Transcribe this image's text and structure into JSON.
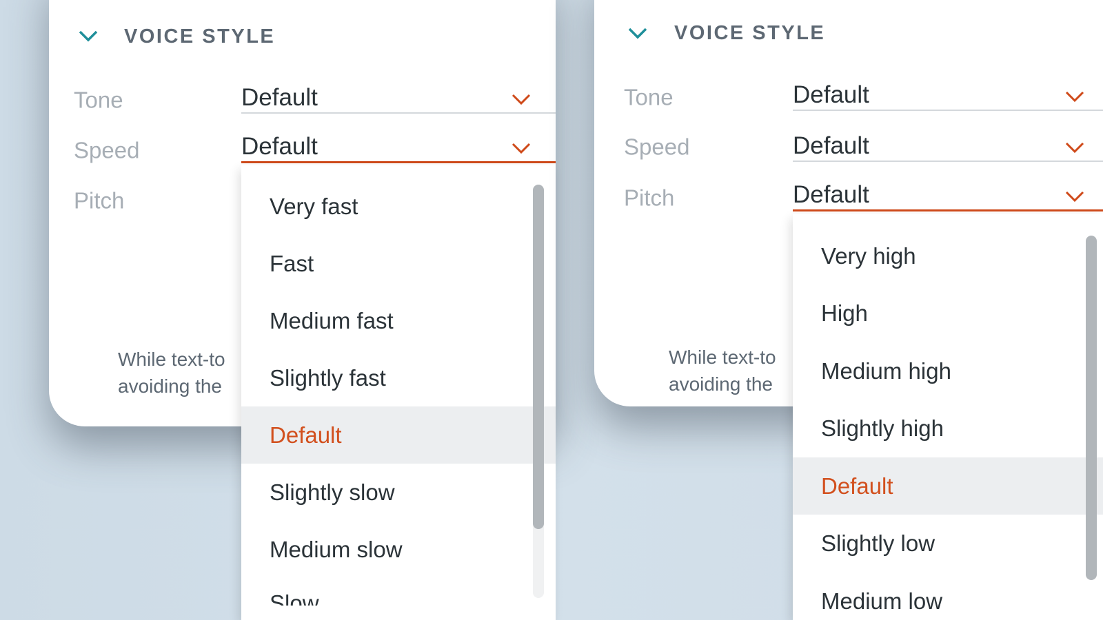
{
  "colors": {
    "accent": "#cf4a1a",
    "teal": "#1f8f9a",
    "background": "#d3e0ea"
  },
  "left": {
    "section_title": "VOICE STYLE",
    "fields": [
      {
        "label": "Tone",
        "value": "Default"
      },
      {
        "label": "Speed",
        "value": "Default"
      },
      {
        "label": "Pitch",
        "value": ""
      }
    ],
    "footer": [
      "While text-to",
      "avoiding the"
    ],
    "dropdown": {
      "options": [
        "Very fast",
        "Fast",
        "Medium fast",
        "Slightly fast",
        "Default",
        "Slightly slow",
        "Medium slow",
        "Slow"
      ],
      "selected": "Default"
    }
  },
  "right": {
    "section_title": "VOICE STYLE",
    "fields": [
      {
        "label": "Tone",
        "value": "Default"
      },
      {
        "label": "Speed",
        "value": "Default"
      },
      {
        "label": "Pitch",
        "value": "Default"
      }
    ],
    "footer": [
      "While text-to",
      "avoiding the"
    ],
    "dropdown": {
      "options": [
        "Very high",
        "High",
        "Medium high",
        "Slightly high",
        "Default",
        "Slightly low",
        "Medium low"
      ],
      "selected": "Default"
    }
  }
}
